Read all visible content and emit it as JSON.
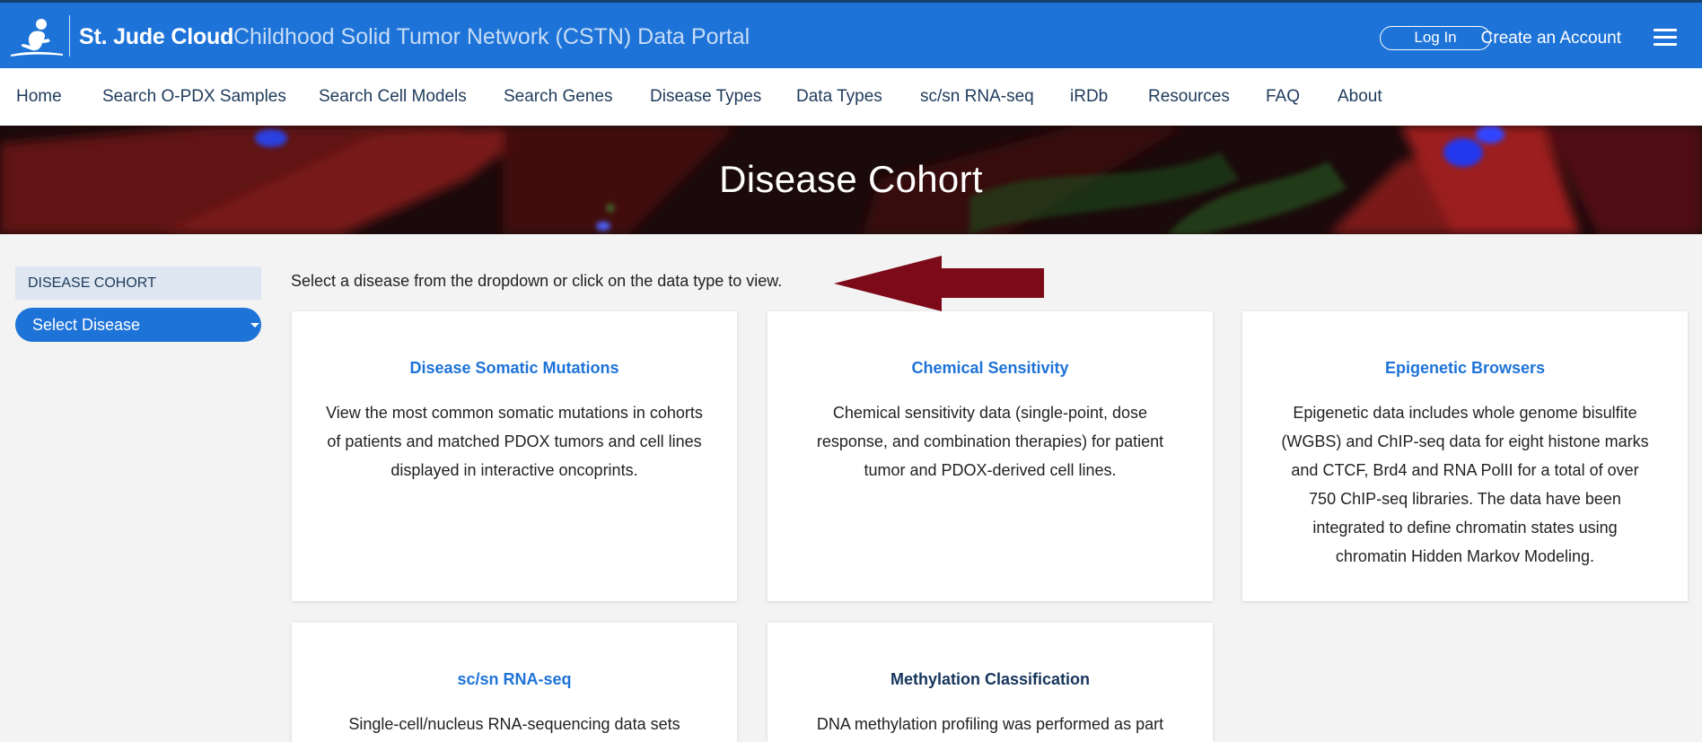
{
  "header": {
    "brand": "St. Jude Cloud",
    "portal_title": "Childhood Solid Tumor Network (CSTN) Data Portal",
    "login_label": "Log In",
    "create_account_label": "Create an Account",
    "logo_icon": "st-jude-child-logo-icon",
    "menu_icon": "hamburger-menu-icon"
  },
  "nav": {
    "items": [
      "Home",
      "Search O-PDX Samples",
      "Search Cell Models",
      "Search Genes",
      "Disease Types",
      "Data Types",
      "sc/sn RNA-seq",
      "iRDb",
      "Resources",
      "FAQ",
      "About"
    ]
  },
  "hero": {
    "title": "Disease Cohort"
  },
  "sidebar": {
    "header": "DISEASE COHORT",
    "select_label": "Select Disease"
  },
  "main": {
    "instructions": "Select a disease from the dropdown or click on the data type to view."
  },
  "cards": [
    {
      "title": "Disease Somatic Mutations",
      "description": "View the most common somatic mutations in cohorts of patients and matched PDOX tumors and cell lines displayed in interactive oncoprints."
    },
    {
      "title": "Chemical Sensitivity",
      "description": "Chemical sensitivity data (single-point, dose response, and combination therapies) for patient tumor and PDOX-derived cell lines."
    },
    {
      "title": "Epigenetic Browsers",
      "description": "Epigenetic data includes whole genome bisulfite (WGBS) and ChIP-seq data for eight histone marks and CTCF, Brd4 and RNA PolII for a total of over 750 ChIP-seq libraries. The data have been integrated to define chromatin states using chromatin Hidden Markov Modeling."
    },
    {
      "title": "sc/sn RNA-seq",
      "description": "Single-cell/nucleus RNA-sequencing data sets"
    },
    {
      "title": "Methylation Classification",
      "description": "DNA methylation profiling was performed as part"
    }
  ],
  "colors": {
    "brand_blue": "#1e73d8",
    "nav_text": "#1f3b5c",
    "arrow": "#7d0a19"
  }
}
